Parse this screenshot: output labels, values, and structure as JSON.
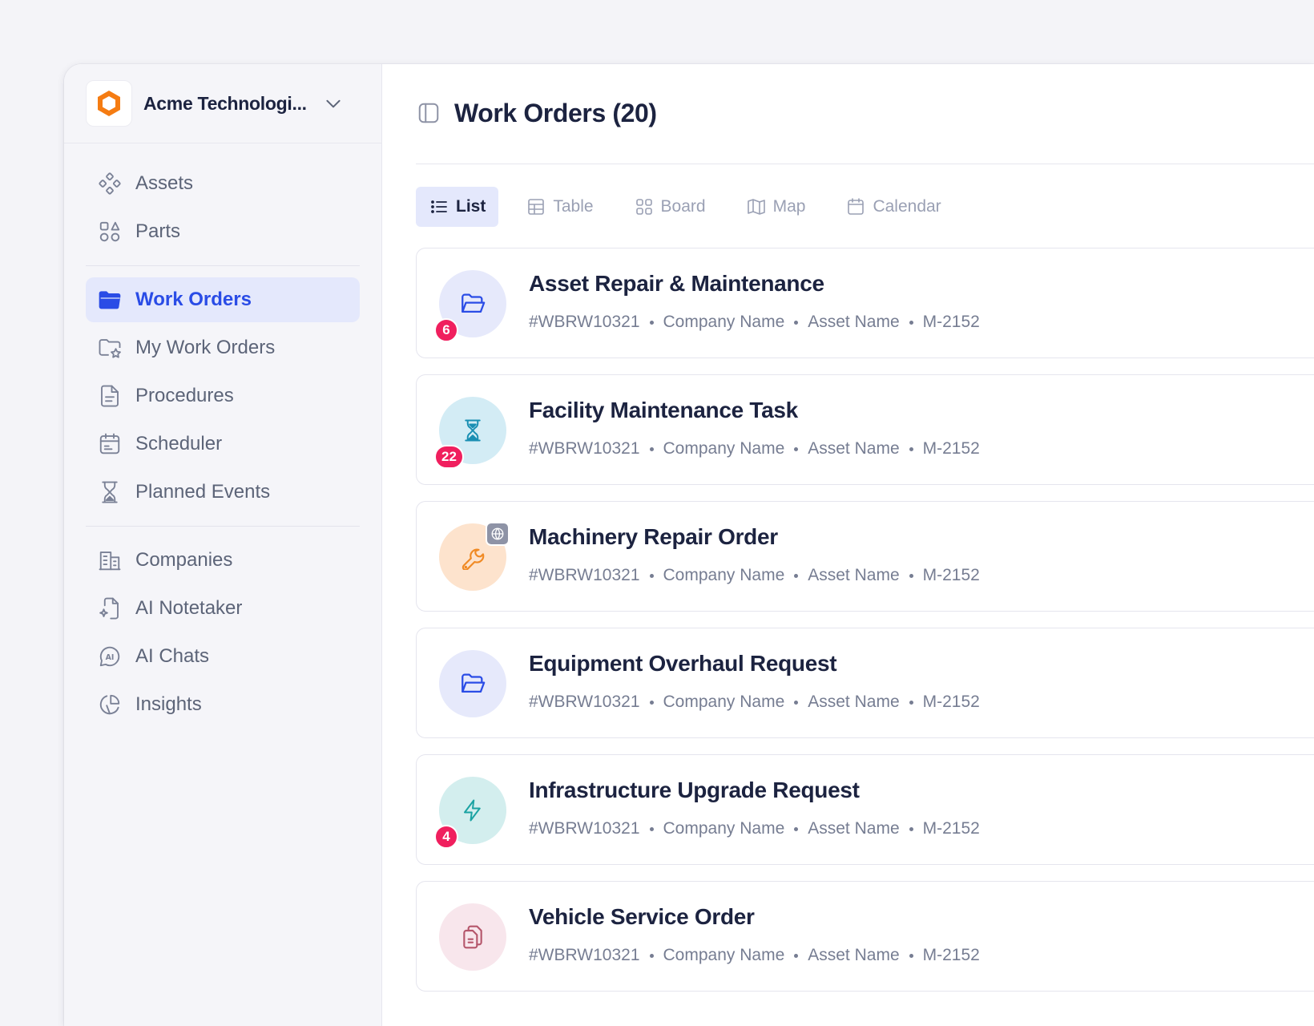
{
  "org": {
    "name": "Acme Technologi..."
  },
  "sidebar": {
    "groups": [
      [
        {
          "id": "assets",
          "label": "Assets",
          "icon": "assets-icon"
        },
        {
          "id": "parts",
          "label": "Parts",
          "icon": "parts-icon"
        }
      ],
      [
        {
          "id": "work-orders",
          "label": "Work Orders",
          "icon": "folder-icon",
          "active": true
        },
        {
          "id": "my-work-orders",
          "label": "My Work Orders",
          "icon": "folder-star-icon"
        },
        {
          "id": "procedures",
          "label": "Procedures",
          "icon": "document-icon"
        },
        {
          "id": "scheduler",
          "label": "Scheduler",
          "icon": "calendar-icon"
        },
        {
          "id": "planned-events",
          "label": "Planned Events",
          "icon": "hourglass-icon"
        }
      ],
      [
        {
          "id": "companies",
          "label": "Companies",
          "icon": "building-icon"
        },
        {
          "id": "ai-notetaker",
          "label": "AI Notetaker",
          "icon": "ai-note-icon"
        },
        {
          "id": "ai-chats",
          "label": "AI Chats",
          "icon": "ai-chat-icon"
        },
        {
          "id": "insights",
          "label": "Insights",
          "icon": "pie-chart-icon"
        }
      ]
    ]
  },
  "header": {
    "title": "Work Orders (20)"
  },
  "views": [
    {
      "id": "list",
      "label": "List",
      "icon": "list-icon",
      "active": true
    },
    {
      "id": "table",
      "label": "Table",
      "icon": "table-icon"
    },
    {
      "id": "board",
      "label": "Board",
      "icon": "board-icon"
    },
    {
      "id": "map",
      "label": "Map",
      "icon": "map-icon"
    },
    {
      "id": "calendar",
      "label": "Calendar",
      "icon": "calendar-icon"
    }
  ],
  "colors": {
    "accent": "#2a4ce6",
    "badge": "#f01f5e"
  },
  "work_orders": [
    {
      "title": "Asset Repair & Maintenance",
      "id": "#WBRW10321",
      "company": "Company Name",
      "asset": "Asset Name",
      "code": "M-2152",
      "icon": "folder-open-icon",
      "bg": "#e6e9fb",
      "fg": "#2a4ce6",
      "badge": "6"
    },
    {
      "title": "Facility Maintenance Task",
      "id": "#WBRW10321",
      "company": "Company Name",
      "asset": "Asset Name",
      "code": "M-2152",
      "icon": "hourglass-icon",
      "bg": "#d3ecf5",
      "fg": "#1a8fb3",
      "badge": "22"
    },
    {
      "title": "Machinery Repair Order",
      "id": "#WBRW10321",
      "company": "Company Name",
      "asset": "Asset Name",
      "code": "M-2152",
      "icon": "wrench-icon",
      "bg": "#fde3cd",
      "fg": "#f08a24",
      "globe": true
    },
    {
      "title": "Equipment Overhaul Request",
      "id": "#WBRW10321",
      "company": "Company Name",
      "asset": "Asset Name",
      "code": "M-2152",
      "icon": "folder-open-icon",
      "bg": "#e6e9fb",
      "fg": "#2a4ce6"
    },
    {
      "title": "Infrastructure Upgrade Request",
      "id": "#WBRW10321",
      "company": "Company Name",
      "asset": "Asset Name",
      "code": "M-2152",
      "icon": "lightning-icon",
      "bg": "#d3eeee",
      "fg": "#1ba3a3",
      "badge": "4"
    },
    {
      "title": "Vehicle Service Order",
      "id": "#WBRW10321",
      "company": "Company Name",
      "asset": "Asset Name",
      "code": "M-2152",
      "icon": "files-icon",
      "bg": "#f8e6ec",
      "fg": "#b5566b"
    }
  ]
}
